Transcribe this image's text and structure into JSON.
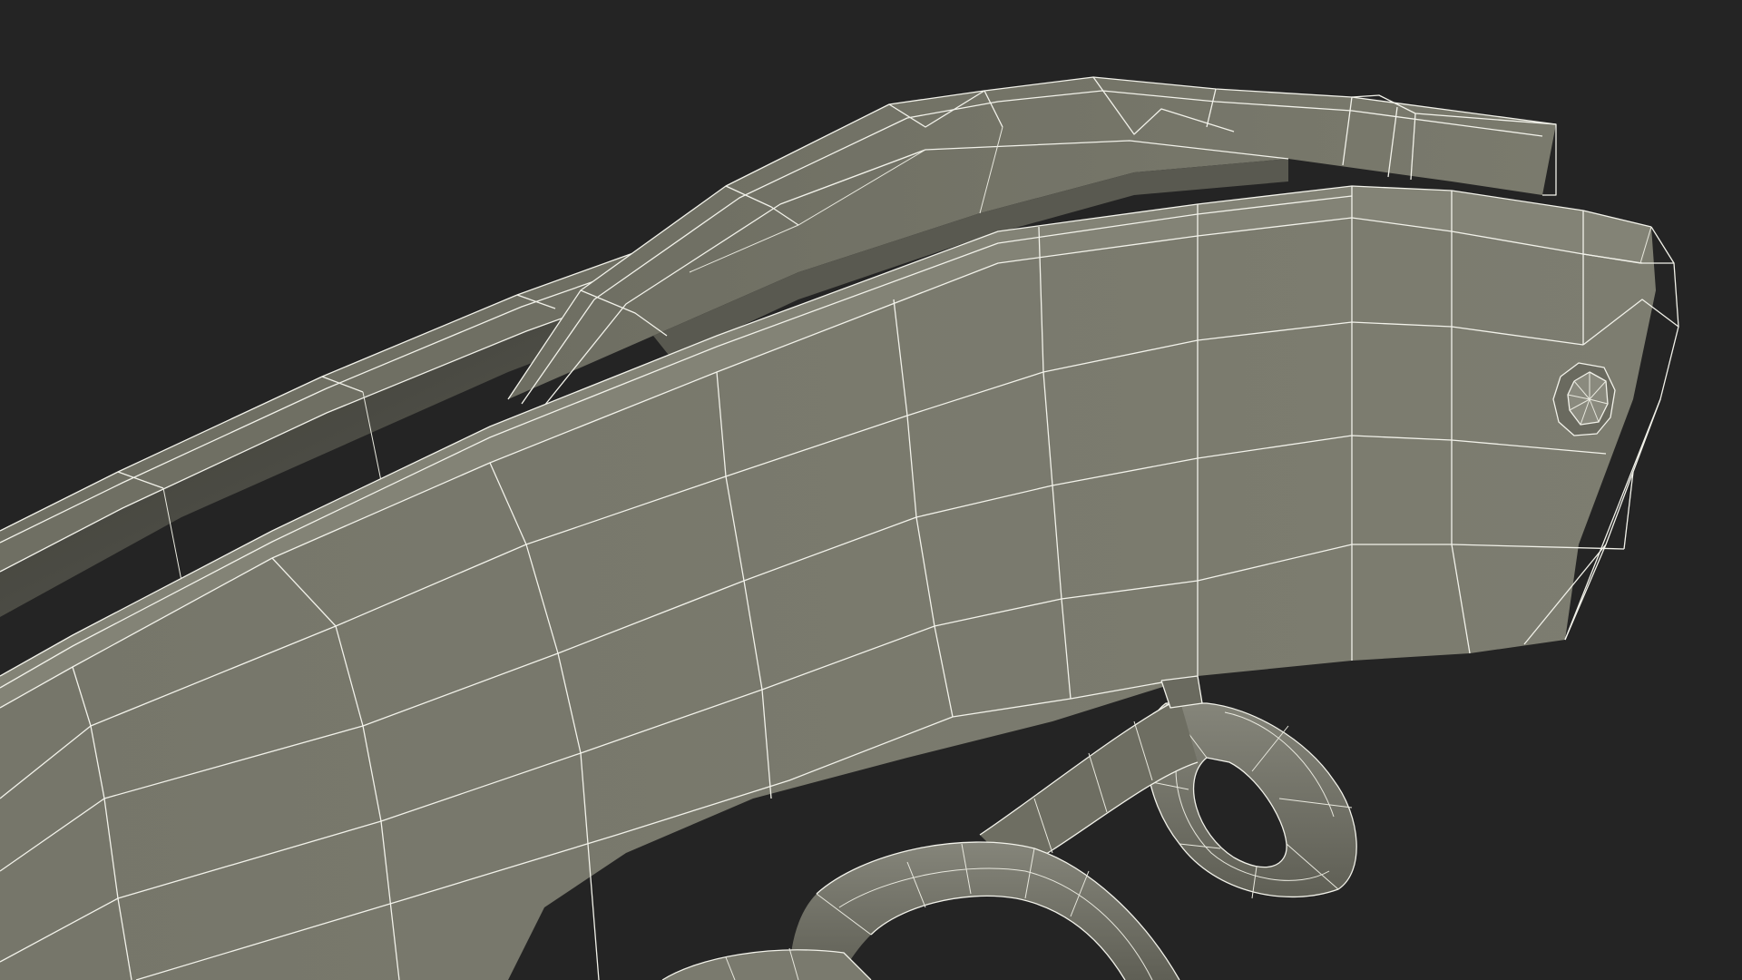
{
  "viewport": {
    "background_color": "#242424",
    "subject": "wireframe-3d-render",
    "mesh_fill_color": "#7b7b6e",
    "mesh_shadow_color": "#4a4a42",
    "wire_color": "#f2f2ea"
  },
  "icons": {
    "screw": "hex-screw-icon"
  }
}
